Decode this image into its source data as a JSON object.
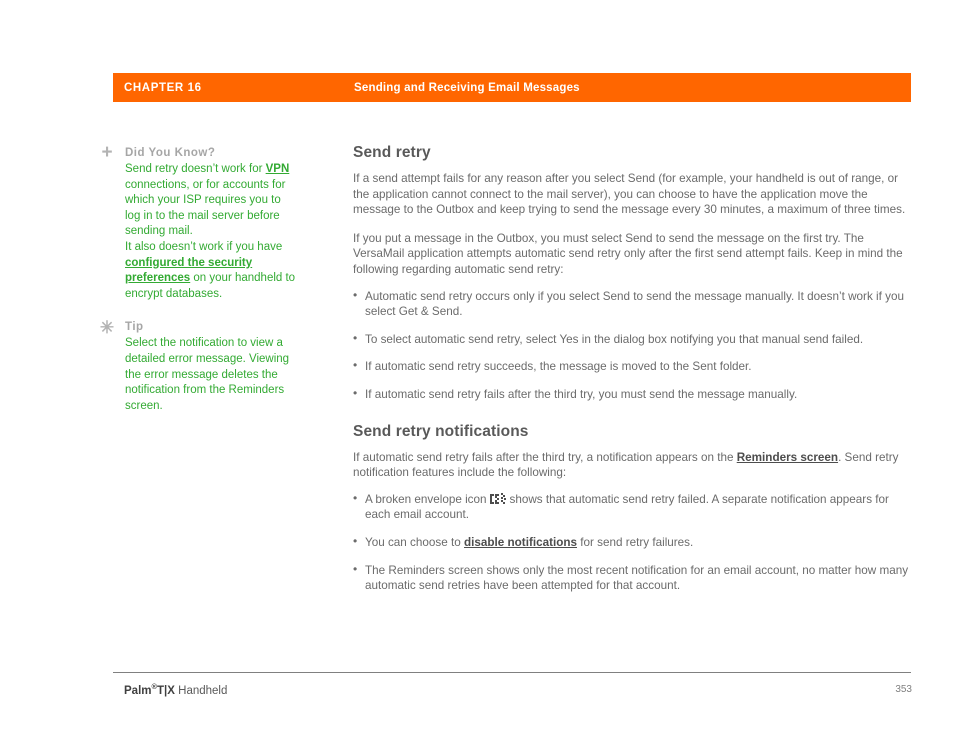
{
  "header": {
    "chapter": "CHAPTER 16",
    "title": "Sending and Receiving Email Messages",
    "bar_color": "#ff6600"
  },
  "sidebar": {
    "notes": [
      {
        "icon": "plus-icon",
        "icon_glyph": "+",
        "heading": "Did You Know?",
        "segments": [
          {
            "text": "Send retry doesn’t work for ",
            "link": false
          },
          {
            "text": "VPN",
            "link": true
          },
          {
            "text": " connections, or for accounts for which your ISP requires you to log in to the mail server before sending mail.",
            "link": false
          },
          {
            "text": "\n",
            "link": false
          },
          {
            "text": "It also doesn’t work if you have ",
            "link": false
          },
          {
            "text": "configured the security preferences",
            "link": true
          },
          {
            "text": " on your handheld to encrypt databases.",
            "link": false
          }
        ]
      },
      {
        "icon": "asterisk-icon",
        "icon_glyph": "✳",
        "heading": "Tip",
        "segments": [
          {
            "text": "Select the notification to view a detailed error message. Viewing the error message deletes the notification from the Reminders screen.",
            "link": false
          }
        ]
      }
    ],
    "text_color": "#33aa33",
    "heading_color": "#a6a6a6"
  },
  "main": {
    "section1": {
      "heading": "Send retry",
      "paragraph1": "If a send attempt fails for any reason after you select Send (for example, your handheld is out of range, or the application cannot connect to the mail server), you can choose to have the application move the message to the Outbox and keep trying to send the message every 30 minutes, a maximum of three times.",
      "paragraph2": "If you put a message in the Outbox, you must select Send to send the message on the first try. The VersaMail application attempts automatic send retry only after the first send attempt fails. Keep in mind the following regarding automatic send retry:",
      "bullets": [
        "Automatic send retry occurs only if you select Send to send the message manually. It doesn’t work if you select Get & Send.",
        "To select automatic send retry, select Yes in the dialog box notifying you that manual send failed.",
        "If automatic send retry succeeds, the message is moved to the Sent folder.",
        "If automatic send retry fails after the third try, you must send the message manually."
      ]
    },
    "section2": {
      "heading": "Send retry notifications",
      "paragraph1_part1": "If automatic send retry fails after the third try, a notification appears on the ",
      "paragraph1_link": "Reminders screen",
      "paragraph1_part2": ". Send retry notification features include the following:",
      "bullet1_part1": "A broken envelope icon",
      "bullet1_icon": "broken-envelope-icon",
      "bullet1_part2": "shows that automatic send retry failed. A separate notification appears for each email account.",
      "bullet2_part1": "You can choose to ",
      "bullet2_link": "disable notifications",
      "bullet2_part2": " for send retry failures.",
      "bullet3": "The Reminders screen shows only the most recent notification for an email account, no matter how many automatic send retries have been attempted for that account."
    }
  },
  "footer": {
    "brand": "Palm",
    "registered": "®",
    "model": "T|X",
    "product": " Handheld",
    "page_number": "353"
  }
}
